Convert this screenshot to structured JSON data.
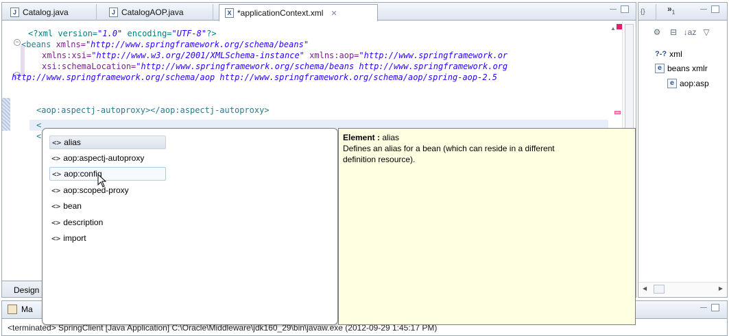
{
  "editor": {
    "tabs": [
      {
        "label": "Catalog.java",
        "icon": "java-file-icon",
        "icon_glyph": "J"
      },
      {
        "label": "CatalogAOP.java",
        "icon": "java-file-icon",
        "icon_glyph": "J"
      },
      {
        "label": "*applicationContext.xml",
        "icon": "xml-file-icon",
        "icon_glyph": "X",
        "active": true
      }
    ],
    "code_lines": {
      "l1_a": "<?xml version=",
      "l1_b": "\"1.0\"",
      "l1_c": " encoding=",
      "l1_d": "\"UTF-8\"",
      "l1_e": "?>",
      "l2_a": "<beans ",
      "l2_b": "xmlns=",
      "l2_c": "\"http://www.springframework.org/schema/beans\"",
      "l3_a": "xmlns:xsi=",
      "l3_b": "\"http://www.w3.org/2001/XMLSchema-instance\"",
      "l3_c": " xmlns:aop=",
      "l3_d": "\"http://www.springframework.or",
      "l4_a": "xsi:schemaLocation=",
      "l4_b": "\"http://www.springframework.org/schema/beans http://www.springframework.org",
      "l5": "http://www.springframework.org/schema/aop http://www.springframework.org/schema/aop/spring-aop-2.5",
      "l7": "<aop:aspectj-autoproxy></aop:aspectj-autoproxy>",
      "l8": "<",
      "l9": "<"
    },
    "design_tab_label": "Design"
  },
  "assist": {
    "proposals": [
      {
        "label": "alias",
        "selected": true
      },
      {
        "label": "aop:aspectj-autoproxy"
      },
      {
        "label": "aop:config",
        "hover": true
      },
      {
        "label": "aop:scoped-proxy"
      },
      {
        "label": "bean"
      },
      {
        "label": "description"
      },
      {
        "label": "import"
      }
    ],
    "proposal_icon": "<>",
    "doc_title_key": "Element :",
    "doc_title_value": " alias",
    "doc_line1": "Defines an alias for a bean (which can reside in a different",
    "doc_line2": " definition resource)."
  },
  "outline": {
    "overflow_label": "»",
    "overflow_count": "1",
    "tree": [
      {
        "label": "xml",
        "icon": "processing-instruction-icon",
        "glyph": "?-?"
      },
      {
        "label": "beans xmlr",
        "icon": "element-icon",
        "glyph": "e"
      },
      {
        "label": "aop:asp",
        "icon": "element-icon",
        "glyph": "e"
      }
    ],
    "sort_glyph": "↓az"
  },
  "console": {
    "tab_label": "Ma",
    "terminated_line": "<terminated> SpringClient [Java Application] C:\\Oracle\\Middleware\\jdk160_29\\bin\\javaw.exe (2012-09-29 1:45:17 PM)"
  },
  "colors": {
    "tag": "#2c7a8c",
    "attr": "#7a1f8a",
    "value": "#2a00ff",
    "doc_bg": "#ffffe1"
  }
}
